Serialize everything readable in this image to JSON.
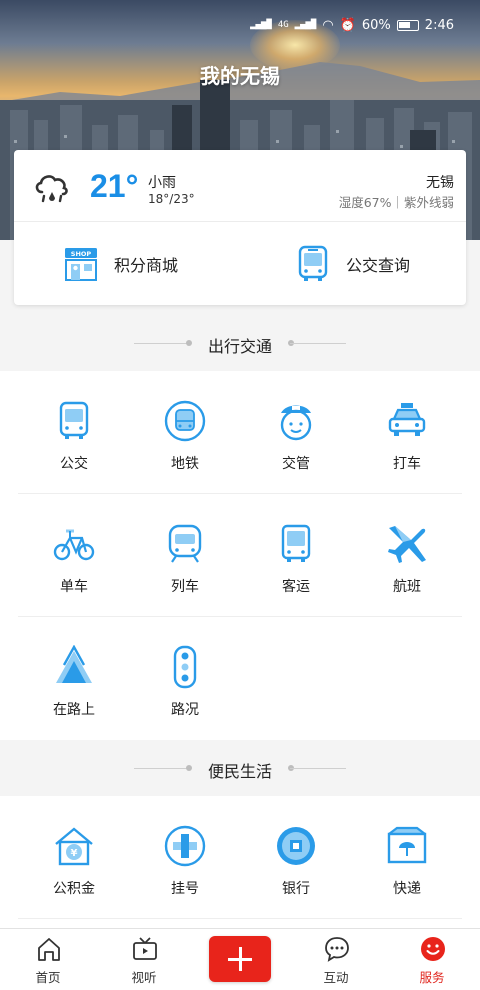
{
  "status": {
    "network": "4G",
    "battery": "60%",
    "time": "2:46"
  },
  "header": {
    "title": "我的无锡"
  },
  "weather": {
    "temperature": "21°",
    "condition": "小雨",
    "range": "18°/23°",
    "city": "无锡",
    "detail": "湿度67%｜紫外线弱",
    "icon": "cloud-rain-icon"
  },
  "quick_links": [
    {
      "label": "积分商城",
      "icon": "shop-icon"
    },
    {
      "label": "公交查询",
      "icon": "bus-icon"
    }
  ],
  "sections": [
    {
      "title": "出行交通",
      "items": [
        {
          "label": "公交",
          "icon": "bus-icon"
        },
        {
          "label": "地铁",
          "icon": "metro-icon"
        },
        {
          "label": "交管",
          "icon": "traffic-police-icon"
        },
        {
          "label": "打车",
          "icon": "taxi-icon"
        },
        {
          "label": "单车",
          "icon": "bicycle-icon"
        },
        {
          "label": "列车",
          "icon": "train-icon"
        },
        {
          "label": "客运",
          "icon": "coach-icon"
        },
        {
          "label": "航班",
          "icon": "airplane-icon"
        },
        {
          "label": "在路上",
          "icon": "road-icon"
        },
        {
          "label": "路况",
          "icon": "traffic-light-icon"
        }
      ]
    },
    {
      "title": "便民生活",
      "items": [
        {
          "label": "公积金",
          "icon": "housing-fund-icon"
        },
        {
          "label": "挂号",
          "icon": "medical-cross-icon"
        },
        {
          "label": "银行",
          "icon": "bank-coin-icon"
        },
        {
          "label": "快递",
          "icon": "parcel-icon"
        }
      ]
    }
  ],
  "tabbar": [
    {
      "label": "首页",
      "icon": "home-icon"
    },
    {
      "label": "视听",
      "icon": "tv-icon"
    },
    {
      "label": "",
      "icon": "plus-icon"
    },
    {
      "label": "互动",
      "icon": "chat-icon"
    },
    {
      "label": "服务",
      "icon": "smile-icon",
      "active": true
    }
  ],
  "colors": {
    "accent": "#1a8ee6",
    "brand_red": "#e8241b",
    "icon_blue": "#2a9be8"
  }
}
